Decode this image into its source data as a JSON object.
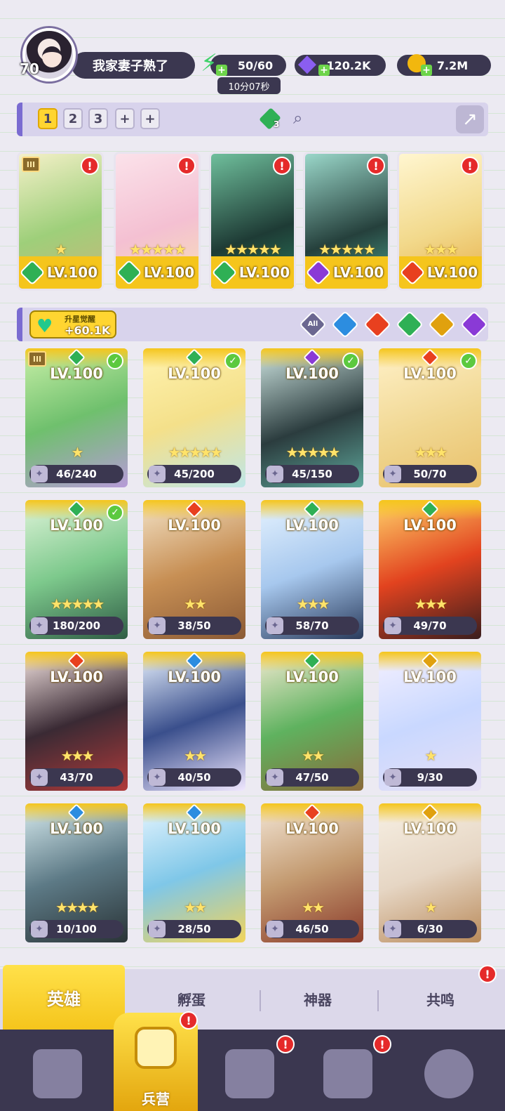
{
  "player": {
    "level": "70",
    "name": "我家妻子熟了"
  },
  "resources": {
    "energy": "50/60",
    "energy_timer": "10分07秒",
    "gems": "120.2K",
    "gold": "7.2M"
  },
  "team_tabs": [
    "1",
    "2",
    "3",
    "+",
    "+"
  ],
  "team_gem_count": "3",
  "team": [
    {
      "level": "LV.100",
      "element": "wind",
      "stars": "★",
      "rank": "III",
      "alert": true
    },
    {
      "level": "LV.100",
      "element": "wind",
      "stars": "★★★★★",
      "alert": true
    },
    {
      "level": "LV.100",
      "element": "wind",
      "stars": "★★★★★",
      "alert": true
    },
    {
      "level": "LV.100",
      "element": "dark",
      "stars": "★★★★★",
      "alert": true
    },
    {
      "level": "LV.100",
      "element": "fire",
      "stars": "★★★",
      "alert": true
    }
  ],
  "awaken": {
    "label": "升星觉醒",
    "value": "+60.1K"
  },
  "filters": {
    "all_label": "All",
    "elements": [
      "water",
      "fire",
      "wind",
      "light",
      "dark"
    ]
  },
  "element_colors": {
    "wind": "#2fb055",
    "fire": "#e8401f",
    "water": "#2c8de0",
    "dark": "#8a3ad6",
    "light": "#e0a10e"
  },
  "heroes": [
    {
      "level": "LV.100",
      "element": "wind",
      "stars": "★",
      "fragments": "46/240",
      "checked": true,
      "rank": "III"
    },
    {
      "level": "LV.100",
      "element": "wind",
      "stars": "★★★★★",
      "fragments": "45/200",
      "checked": true
    },
    {
      "level": "LV.100",
      "element": "dark",
      "stars": "★★★★★",
      "fragments": "45/150",
      "checked": true
    },
    {
      "level": "LV.100",
      "element": "fire",
      "stars": "★★★",
      "fragments": "50/70",
      "checked": true
    },
    {
      "level": "LV.100",
      "element": "wind",
      "stars": "★★★★★",
      "fragments": "180/200",
      "checked": true
    },
    {
      "level": "LV.100",
      "element": "fire",
      "stars": "★★",
      "fragments": "38/50",
      "checked": false
    },
    {
      "level": "LV.100",
      "element": "wind",
      "stars": "★★★",
      "fragments": "58/70",
      "checked": false
    },
    {
      "level": "LV.100",
      "element": "wind",
      "stars": "★★★",
      "fragments": "49/70",
      "checked": false
    },
    {
      "level": "LV.100",
      "element": "fire",
      "stars": "★★★",
      "fragments": "43/70",
      "checked": false
    },
    {
      "level": "LV.100",
      "element": "water",
      "stars": "★★",
      "fragments": "40/50",
      "checked": false
    },
    {
      "level": "LV.100",
      "element": "wind",
      "stars": "★★",
      "fragments": "47/50",
      "checked": false
    },
    {
      "level": "LV.100",
      "element": "light",
      "stars": "★",
      "fragments": "9/30",
      "checked": false
    },
    {
      "level": "LV.100",
      "element": "water",
      "stars": "★★★★",
      "fragments": "10/100",
      "checked": false
    },
    {
      "level": "LV.100",
      "element": "water",
      "stars": "★★",
      "fragments": "28/50",
      "checked": false
    },
    {
      "level": "LV.100",
      "element": "fire",
      "stars": "★★",
      "fragments": "46/50",
      "checked": false
    },
    {
      "level": "LV.100",
      "element": "light",
      "stars": "★",
      "fragments": "6/30",
      "checked": false
    }
  ],
  "subtabs": [
    "英雄",
    "孵蛋",
    "神器",
    "共鸣"
  ],
  "bottom_nav": {
    "active_label": "兵营"
  }
}
